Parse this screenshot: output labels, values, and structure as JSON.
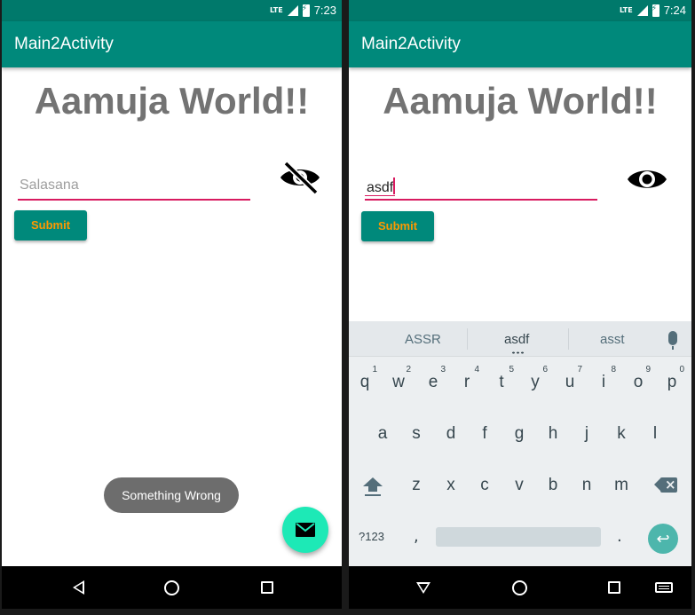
{
  "left": {
    "status_time": "7:23",
    "status_network": "LTE",
    "app_title": "Main2Activity",
    "hero_text": "Aamuja World!!",
    "input_placeholder": "Salasana",
    "eye_icon": "eye-off-icon",
    "submit_label": "Submit",
    "toast_text": "Something Wrong",
    "fab_icon": "email-icon",
    "nav": [
      "back-icon",
      "home-icon",
      "recents-icon"
    ]
  },
  "right": {
    "status_time": "7:24",
    "status_network": "LTE",
    "app_title": "Main2Activity",
    "hero_text": "Aamuja World!!",
    "input_value": "asdf",
    "eye_icon": "eye-icon",
    "submit_label": "Submit",
    "suggestions": [
      "ASSR",
      "asdf",
      "asst"
    ],
    "keyboard": {
      "row1": [
        "q",
        "w",
        "e",
        "r",
        "t",
        "y",
        "u",
        "i",
        "o",
        "p"
      ],
      "row1_numbers": [
        "1",
        "2",
        "3",
        "4",
        "5",
        "6",
        "7",
        "8",
        "9",
        "0"
      ],
      "row2": [
        "a",
        "s",
        "d",
        "f",
        "g",
        "h",
        "j",
        "k",
        "l"
      ],
      "row3": [
        "z",
        "x",
        "c",
        "v",
        "b",
        "n",
        "m"
      ],
      "symbols_key": "?123",
      "comma_key": ",",
      "period_key": "."
    },
    "nav": [
      "collapse-keyboard-icon",
      "home-icon",
      "recents-icon",
      "keyboard-switch-icon"
    ]
  },
  "colors": {
    "primary": "#00897B",
    "primary_dark": "#00796B",
    "accent": "#D81B60",
    "button_text": "#FF9800",
    "fab": "#1DE9B6",
    "hero_text": "#737373"
  }
}
